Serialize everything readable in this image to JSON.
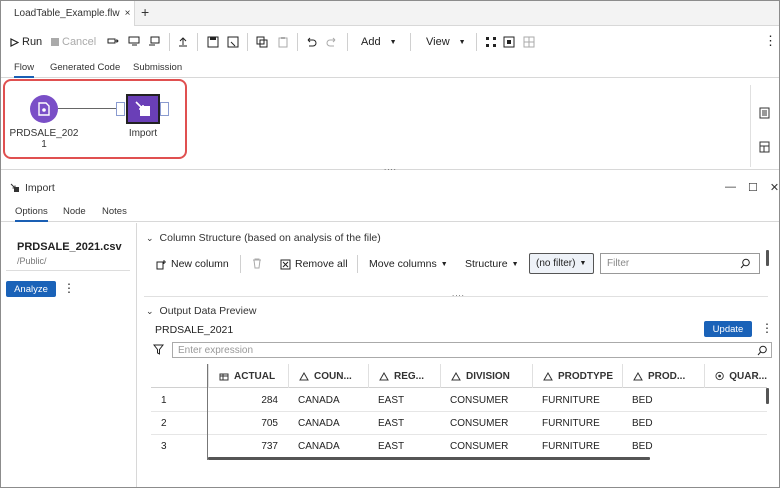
{
  "tabs": {
    "doc_title": "LoadTable_Example.flw",
    "close": "×",
    "add": "+"
  },
  "toolbar": {
    "run": "Run",
    "cancel": "Cancel",
    "add": "Add",
    "view": "View",
    "more": "⋮"
  },
  "subtabs": [
    "Flow",
    "Generated Code",
    "Submission"
  ],
  "flow": {
    "node1_label_line1": "PRDSALE_202",
    "node1_label_line2": "1",
    "node2_label": "Import",
    "grip": "....",
    "grip2": "...."
  },
  "pane": {
    "title": "Import",
    "tabs": [
      "Options",
      "Node",
      "Notes"
    ]
  },
  "left": {
    "file_name": "PRDSALE_2021.csv",
    "file_path": "/Public/",
    "analyze": "Analyze",
    "more": "⋮"
  },
  "column_structure": {
    "heading": "Column Structure (based on analysis of the file)",
    "new_column": "New column",
    "remove_all": "Remove all",
    "move_columns": "Move columns",
    "structure": "Structure",
    "filter_select": "(no filter)",
    "filter_placeholder": "Filter"
  },
  "output_preview": {
    "heading": "Output Data Preview",
    "table_name": "PRDSALE_2021",
    "update": "Update",
    "more": "⋮",
    "expression_placeholder": "Enter expression"
  },
  "table": {
    "columns": [
      "ACTUAL",
      "COUN...",
      "REG...",
      "DIVISION",
      "PRODTYPE",
      "PROD...",
      "QUAR..."
    ],
    "rows": [
      [
        "1",
        "284",
        "CANADA",
        "EAST",
        "CONSUMER",
        "FURNITURE",
        "BED",
        ""
      ],
      [
        "2",
        "705",
        "CANADA",
        "EAST",
        "CONSUMER",
        "FURNITURE",
        "BED",
        ""
      ],
      [
        "3",
        "737",
        "CANADA",
        "EAST",
        "CONSUMER",
        "FURNITURE",
        "BED",
        ""
      ]
    ]
  },
  "colors": {
    "accent": "#1a62b8",
    "node": "#7a4fc7",
    "highlight": "#e05050"
  }
}
